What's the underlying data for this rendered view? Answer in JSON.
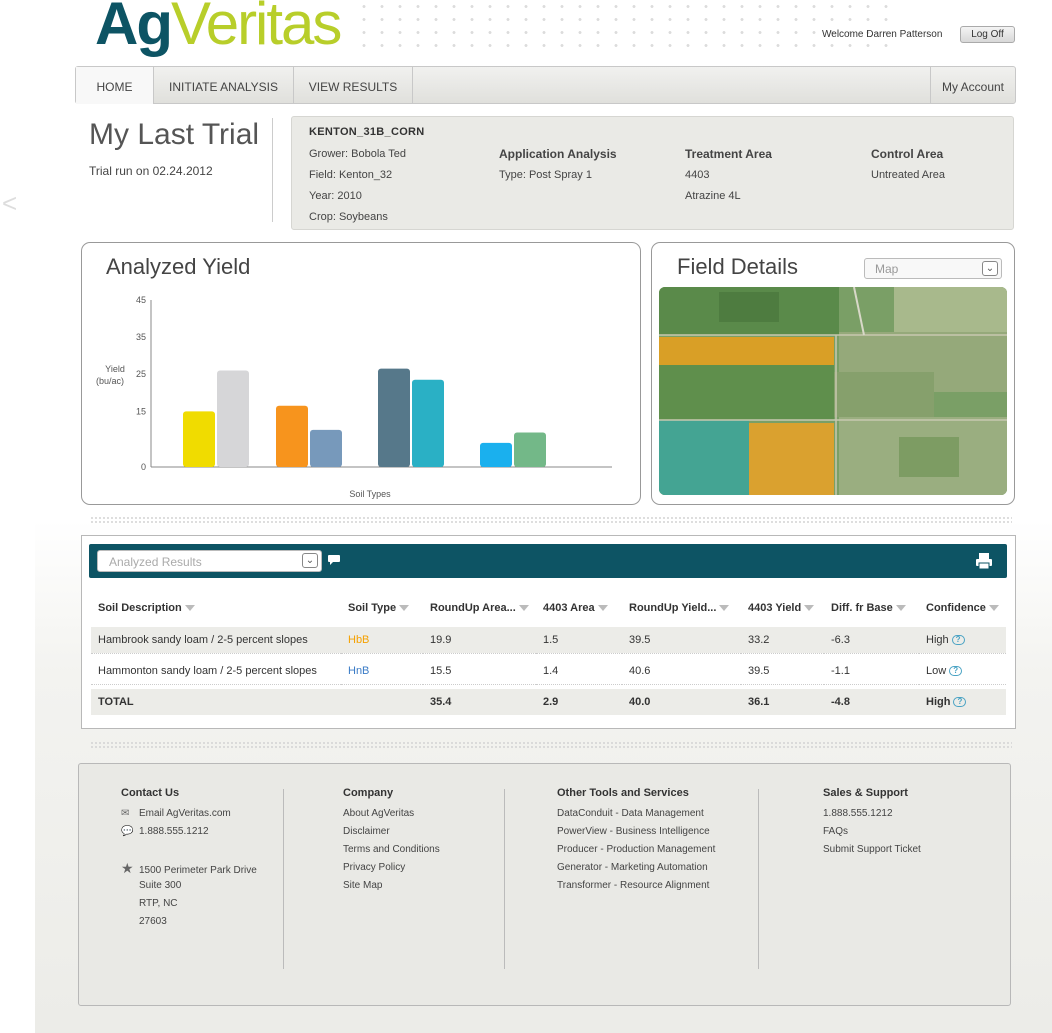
{
  "header": {
    "logo_ag": "Ag",
    "logo_veritas": "Veritas",
    "welcome": "Welcome Darren Patterson",
    "logoff_label": "Log Off"
  },
  "nav": {
    "tabs": [
      {
        "label": "HOME",
        "active": true
      },
      {
        "label": "INITIATE ANALYSIS",
        "active": false
      },
      {
        "label": "VIEW RESULTS",
        "active": false
      }
    ],
    "account_label": "My Account"
  },
  "trial": {
    "title": "My Last Trial",
    "run_date": "Trial run on 02.24.2012",
    "code": "KENTON_31B_CORN",
    "grower": "Grower: Bobola Ted",
    "field": "Field: Kenton_32",
    "year": "Year: 2010",
    "crop": "Crop: Soybeans",
    "application_head": "Application Analysis",
    "application_type": "Type: Post Spray 1",
    "treatment_head": "Treatment Area",
    "treatment_id": "4403",
    "treatment_product": "Atrazine 4L",
    "control_head": "Control Area",
    "control_value": "Untreated Area"
  },
  "yield_panel": {
    "title": "Analyzed Yield"
  },
  "chart_data": {
    "type": "bar",
    "title": "Analyzed Yield",
    "xlabel": "Soil Types",
    "ylabel": "Yield (bu/ac)",
    "ylabel_line1": "Yield",
    "ylabel_line2": "(bu/ac)",
    "ylim": [
      0,
      45
    ],
    "yticks": [
      "45",
      "35",
      "25",
      "15",
      "0"
    ],
    "ytick_values": [
      45,
      35,
      25,
      15,
      0
    ],
    "grid": false,
    "groups": [
      {
        "bars": [
          {
            "value": 15,
            "color": "#f0dc00"
          },
          {
            "value": 26,
            "color": "#d6d6d8"
          }
        ]
      },
      {
        "bars": [
          {
            "value": 16.5,
            "color": "#f7941d"
          },
          {
            "value": 10,
            "color": "#7799bb"
          }
        ]
      },
      {
        "bars": [
          {
            "value": 26.5,
            "color": "#56788a"
          },
          {
            "value": 23.5,
            "color": "#2ab0c5"
          }
        ]
      },
      {
        "bars": [
          {
            "value": 6.5,
            "color": "#1ab0ee"
          },
          {
            "value": 9.3,
            "color": "#73b888"
          }
        ]
      }
    ]
  },
  "field_panel": {
    "title": "Field Details",
    "view_select": "Map"
  },
  "results": {
    "select_label": "Analyzed Results",
    "columns": [
      "Soil Description",
      "Soil Type",
      "RoundUp Area...",
      "4403 Area",
      "RoundUp Yield...",
      "4403 Yield",
      "Diff. fr Base",
      "Confidence"
    ],
    "rows": [
      {
        "desc": "Hambrook sandy loam / 2-5 percent slopes",
        "type": "HbB",
        "ru_area": "19.9",
        "area4403": "1.5",
        "ru_yield": "39.5",
        "yield4403": "33.2",
        "diff": "-6.3",
        "conf": "High"
      },
      {
        "desc": "Hammonton sandy loam / 2-5 percent slopes",
        "type": "HnB",
        "ru_area": "15.5",
        "area4403": "1.4",
        "ru_yield": "40.6",
        "yield4403": "39.5",
        "diff": "-1.1",
        "conf": "Low"
      }
    ],
    "total": {
      "label": "TOTAL",
      "ru_area": "35.4",
      "area4403": "2.9",
      "ru_yield": "40.0",
      "yield4403": "36.1",
      "diff": "-4.8",
      "conf": "High"
    }
  },
  "footer": {
    "contact": {
      "head": "Contact Us",
      "email": "Email AgVeritas.com",
      "phone": "1.888.555.1212",
      "addr1": "1500 Perimeter Park Drive",
      "addr2": "Suite 300",
      "addr3": "RTP, NC",
      "addr4": "27603"
    },
    "company": {
      "head": "Company",
      "items": [
        "About AgVeritas",
        "Disclaimer",
        "Terms and Conditions",
        "Privacy Policy",
        "Site Map"
      ]
    },
    "tools": {
      "head": "Other Tools and Services",
      "items": [
        "DataConduit - Data Management",
        "PowerView - Business Intelligence",
        "Producer - Production Management",
        "Generator - Marketing Automation",
        "Transformer - Resource Alignment"
      ]
    },
    "sales": {
      "head": "Sales & Support",
      "items": [
        "1.888.555.1212",
        "FAQs",
        "Submit Support Ticket"
      ]
    }
  }
}
